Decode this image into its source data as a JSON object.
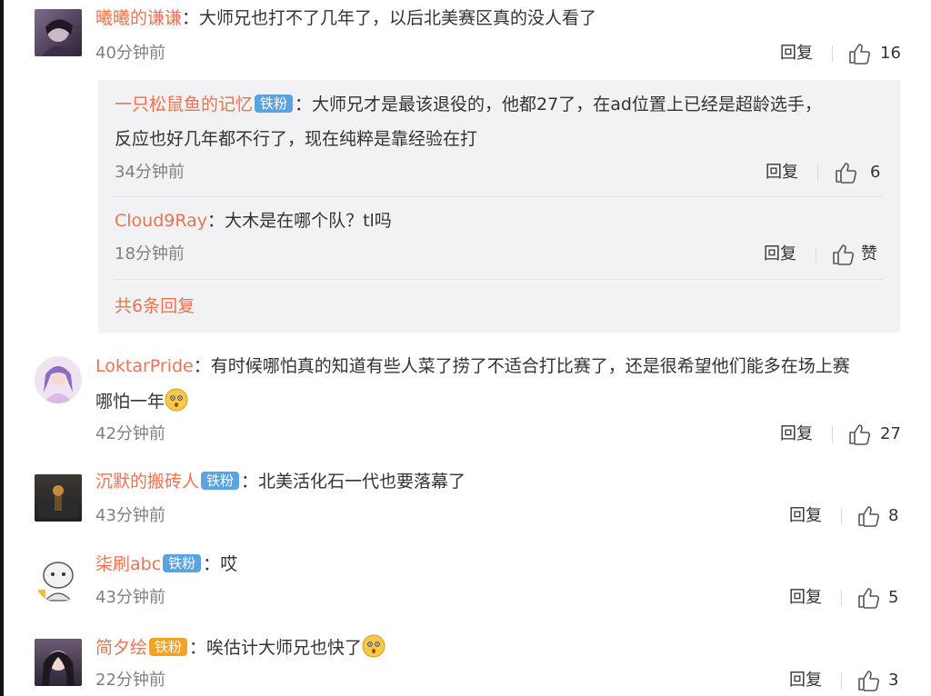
{
  "comments": [
    {
      "name": "曦曦的谦谦",
      "badge": "",
      "text": "大师兄也打不了几年了，以后北美赛区真的没人看了",
      "time": "40分钟前",
      "reply": "回复",
      "likes": "16",
      "emoji": false
    },
    {
      "name": "LoktarPride",
      "badge": "",
      "text": "有时候哪怕真的知道有些人菜了捞了不适合打比赛了，还是很希望他们能多在场上赛",
      "text2": "哪怕一年",
      "time": "42分钟前",
      "reply": "回复",
      "likes": "27",
      "emoji": true
    },
    {
      "name": "沉默的搬砖人",
      "badge": "铁粉",
      "text": "北美活化石一代也要落幕了",
      "time": "43分钟前",
      "reply": "回复",
      "likes": "8"
    },
    {
      "name": "柒刷abc",
      "badge": "铁粉",
      "text": "哎",
      "time": "43分钟前",
      "reply": "回复",
      "likes": "5"
    },
    {
      "name": "简夕绘",
      "badge": "铁粉",
      "text": "唉估计大师兄也快了",
      "time": "22分钟前",
      "reply": "回复",
      "likes": "3",
      "emoji": true
    }
  ],
  "replies": [
    {
      "name": "一只松鼠鱼的记忆",
      "badge": "铁粉",
      "text": "大师兄才是最该退役的，他都27了，在ad位置上已经是超龄选手，",
      "text2": "反应也好几年都不行了，现在纯粹是靠经验在打",
      "time": "34分钟前",
      "reply": "回复",
      "likes": "6"
    },
    {
      "name": "Cloud9Ray",
      "badge": "",
      "text": "大木是在哪个队？tl吗",
      "time": "18分钟前",
      "reply": "回复",
      "likes": "赞"
    }
  ],
  "more_replies": "共6条回复",
  "colors": {
    "name": "#eb7350",
    "badge": "#5aa2e0",
    "subbox": "#f2f2f5"
  }
}
